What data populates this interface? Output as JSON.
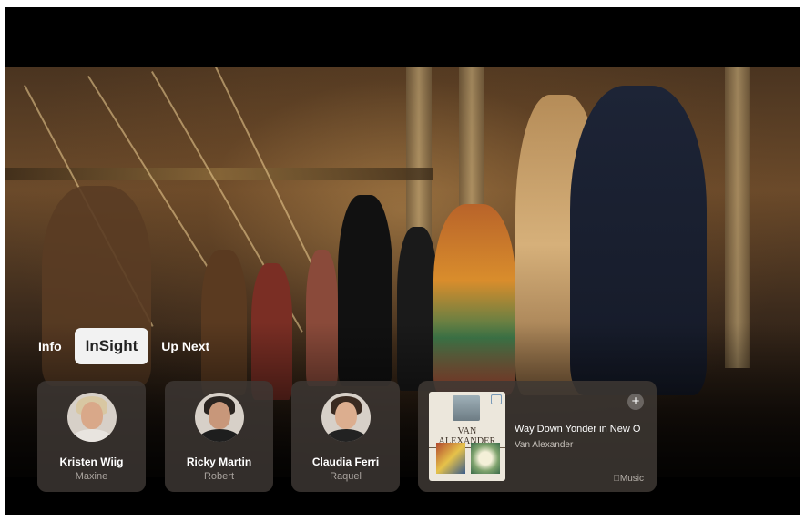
{
  "tabs": [
    {
      "label": "Info",
      "active": false
    },
    {
      "label": "InSight",
      "active": true
    },
    {
      "label": "Up Next",
      "active": false
    }
  ],
  "cast": [
    {
      "name": "Kristen Wiig",
      "role": "Maxine"
    },
    {
      "name": "Ricky Martin",
      "role": "Robert"
    },
    {
      "name": "Claudia Ferri",
      "role": "Raquel"
    }
  ],
  "music": {
    "title": "Way Down Yonder in New O",
    "artist": "Van Alexander",
    "album_text": "VAN ALEXANDER",
    "add_label": "+",
    "brand": "Music"
  },
  "colors": {
    "active_tab_bg": "#f2f2f2",
    "card_bg": "#3e3834"
  }
}
